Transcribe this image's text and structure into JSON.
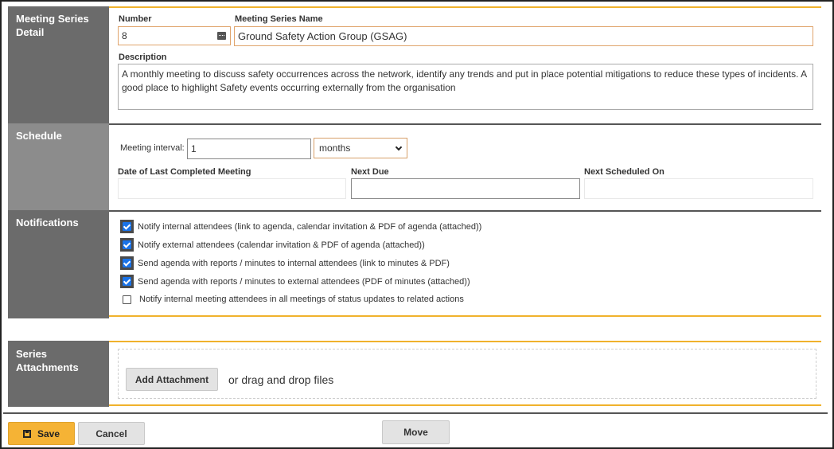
{
  "sections": {
    "detail": {
      "label": "Meeting Series Detail",
      "number_label": "Number",
      "number_value": "8",
      "name_label": "Meeting Series Name",
      "name_value": "Ground Safety Action Group (GSAG)",
      "description_label": "Description",
      "description_value": "A monthly meeting to discuss safety occurrences across the network, identify any trends and put in place potential mitigations to reduce these types of incidents. A good place to highlight Safety events occurring externally from the organisation"
    },
    "schedule": {
      "label": "Schedule",
      "interval_label": "Meeting interval:",
      "interval_value": "1",
      "interval_unit": "months",
      "last_completed_label": "Date of Last Completed Meeting",
      "last_completed_value": "",
      "next_due_label": "Next Due",
      "next_due_value": "",
      "next_scheduled_label": "Next Scheduled On",
      "next_scheduled_value": ""
    },
    "notifications": {
      "label": "Notifications",
      "options": [
        {
          "label": "Notify internal attendees (link to agenda, calendar invitation & PDF of agenda (attached))",
          "checked": true
        },
        {
          "label": "Notify external attendees (calendar invitation & PDF of agenda (attached))",
          "checked": true
        },
        {
          "label": "Send agenda with reports / minutes to internal attendees (link to minutes & PDF)",
          "checked": true
        },
        {
          "label": "Send agenda with reports / minutes to external attendees (PDF of minutes (attached))",
          "checked": true
        },
        {
          "label": "Notify internal meeting attendees in all meetings of status updates to related actions",
          "checked": false
        }
      ]
    },
    "attachments": {
      "label": "Series Attachments",
      "add_button": "Add Attachment",
      "drop_text": "or drag and drop files"
    }
  },
  "footer": {
    "save": "Save",
    "cancel": "Cancel",
    "move": "Move"
  },
  "colors": {
    "accent": "#f0b22c",
    "label_bg": "#6b6b6b",
    "checkbox_blue": "#1a73e8"
  }
}
